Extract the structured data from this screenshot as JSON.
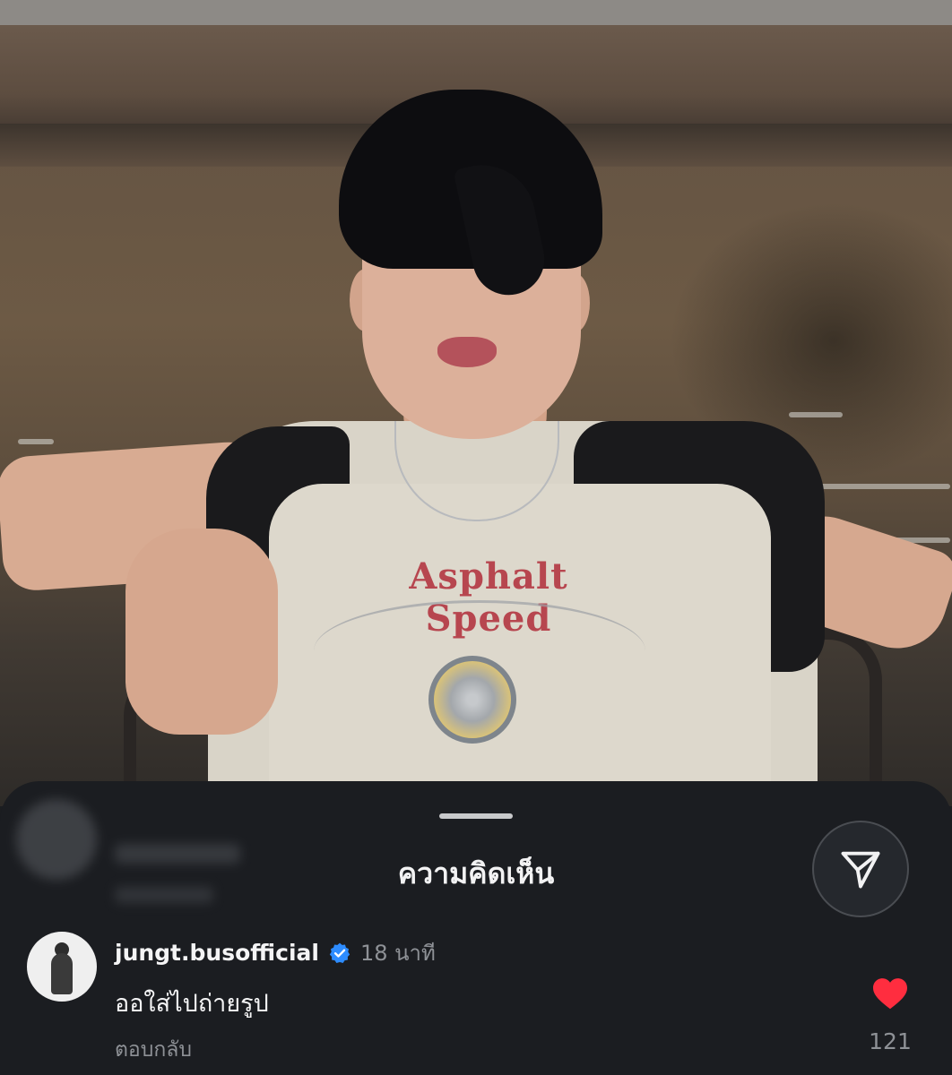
{
  "sheet": {
    "title": "ความคิดเห็น",
    "share_icon": "send-icon"
  },
  "comment": {
    "username": "jungt.busofficial",
    "verified": true,
    "time": "18 นาที",
    "text": "ออใส่ไปถ่ายรูป",
    "reply_label": "ตอบกลับ",
    "like_count": "121",
    "like_icon": "heart-filled-icon"
  },
  "colors": {
    "sheet_bg": "#1b1d21",
    "heart": "#ff2d3f",
    "verified": "#2d8cff",
    "secondary_text": "#8e9196"
  },
  "shirt_print": "Asphalt Speed"
}
